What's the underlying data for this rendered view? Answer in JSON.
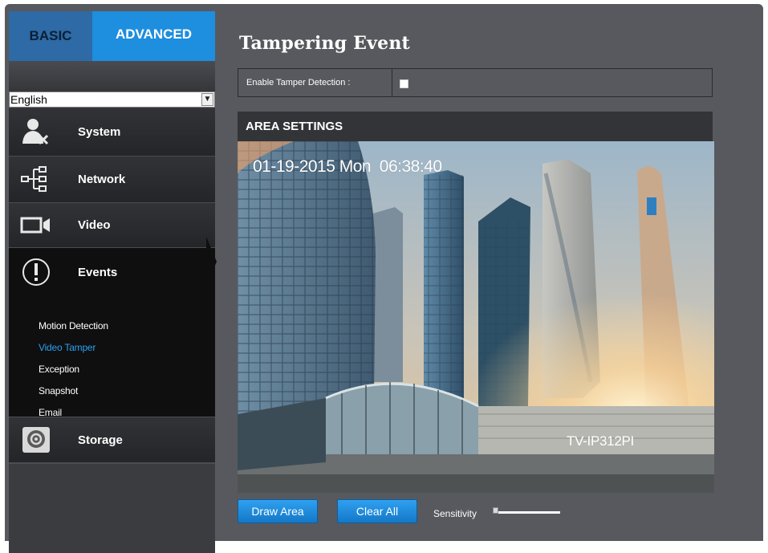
{
  "tabs": {
    "basic": "BASIC",
    "advanced": "ADVANCED"
  },
  "language": {
    "selected": "English"
  },
  "nav": {
    "system": "System",
    "network": "Network",
    "video": "Video",
    "events": "Events",
    "storage": "Storage"
  },
  "events_submenu": {
    "items": [
      "Motion Detection",
      "Video Tamper",
      "Exception",
      "Snapshot",
      "Email"
    ],
    "active": "Video Tamper"
  },
  "page": {
    "title": "Tampering Event",
    "enable_label": "Enable Tamper Detection :",
    "enable_checked": false,
    "area_header": "AREA SETTINGS"
  },
  "camera": {
    "timestamp": "01-19-2015 Mon  06:38:40",
    "device_name": "TV-IP312PI"
  },
  "controls": {
    "draw_area": "Draw Area",
    "clear_all": "Clear All",
    "sensitivity_label": "Sensitivity",
    "sensitivity_level": 0
  },
  "colors": {
    "accent": "#1e8ede",
    "active_link": "#2aa1ee",
    "panel": "#58595e",
    "sidebar": "#3b3c40"
  },
  "icons": {
    "system": "system-user-icon",
    "network": "network-tree-icon",
    "video": "video-camera-icon",
    "events": "alert-exclamation-icon",
    "storage": "storage-disk-icon"
  }
}
